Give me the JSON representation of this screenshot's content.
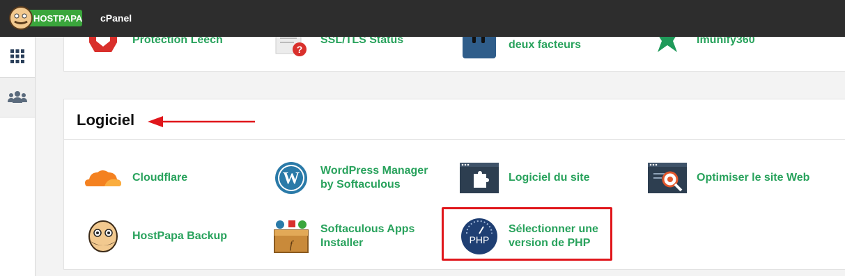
{
  "topbar": {
    "brand": "HOSTPAPA",
    "title": "cPanel"
  },
  "sidebar": {
    "items": [
      {
        "icon": "grid-icon"
      },
      {
        "icon": "users-icon"
      }
    ]
  },
  "top_row": {
    "items": [
      {
        "label": "Protection Leech",
        "icon": "stop-hand-icon"
      },
      {
        "label": "SSL/TLS Status",
        "icon": "ssl-certificate-status-icon"
      },
      {
        "label": "deux facteurs",
        "icon": "two-factor-lock-icon"
      },
      {
        "label": "Imunify360",
        "icon": "imunify-shield-icon"
      }
    ]
  },
  "logiciel": {
    "title": "Logiciel",
    "items": [
      {
        "label": "Cloudflare",
        "icon": "cloudflare-cloud-icon"
      },
      {
        "label": "WordPress Manager by Softaculous",
        "icon": "wordpress-icon"
      },
      {
        "label": "Logiciel du site",
        "icon": "site-software-puzzle-icon"
      },
      {
        "label": "Optimiser le site Web",
        "icon": "optimize-website-icon"
      },
      {
        "label": "HostPapa Backup",
        "icon": "hostpapa-mascot-icon"
      },
      {
        "label": "Softaculous Apps Installer",
        "icon": "softaculous-box-icon"
      },
      {
        "label": "Sélectionner une version de PHP",
        "icon": "php-selector-icon"
      }
    ]
  },
  "colors": {
    "topbar": "#2d2d2d",
    "link": "#28a25c",
    "annotation": "#e0161b"
  }
}
